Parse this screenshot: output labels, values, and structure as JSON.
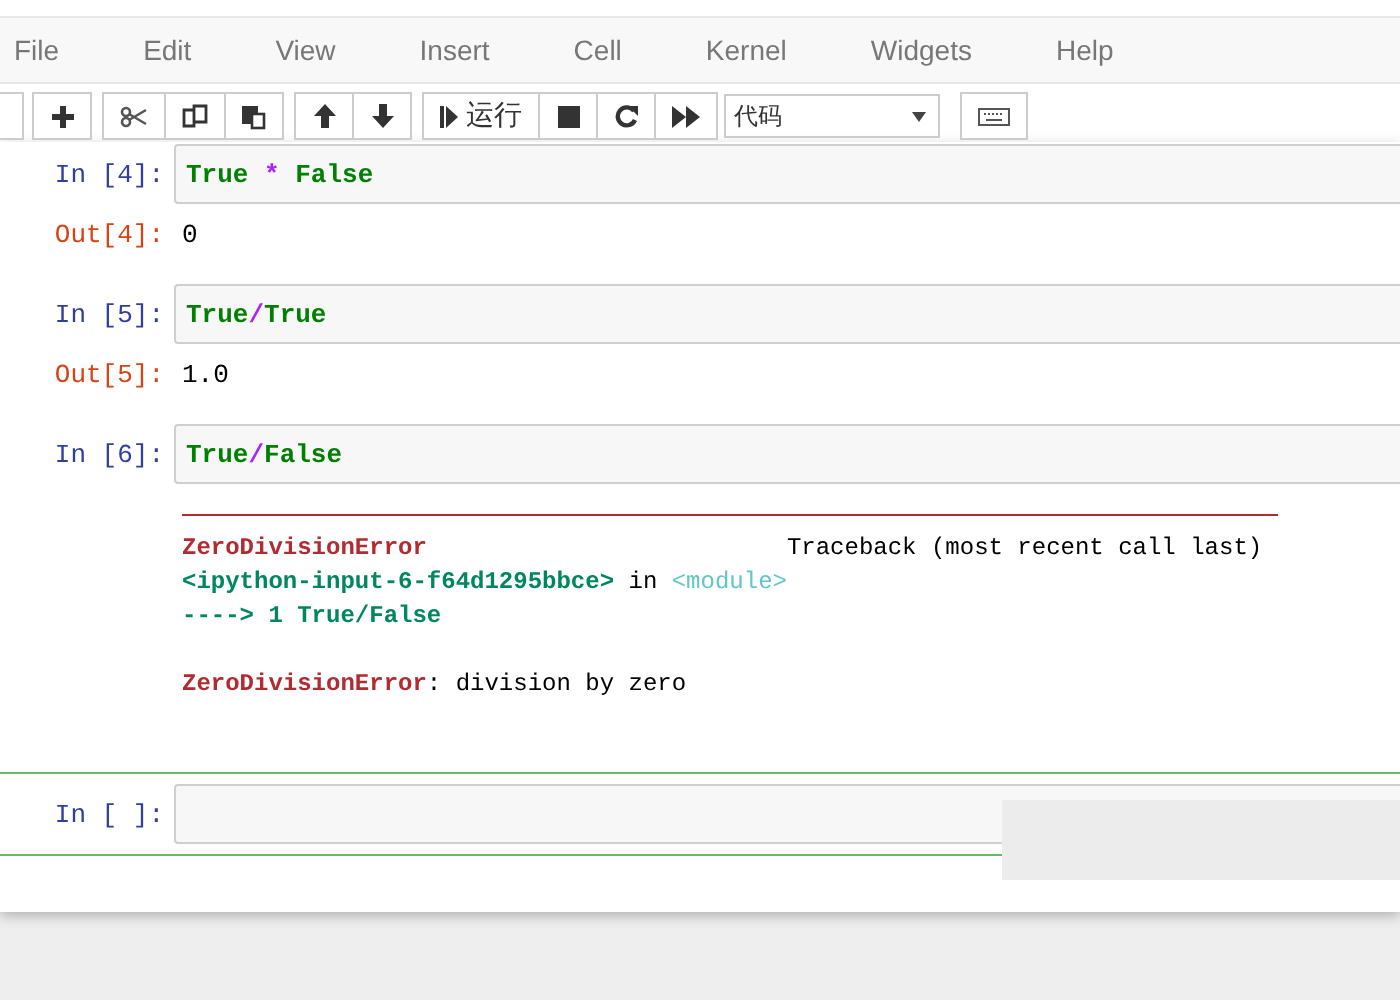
{
  "menu": [
    "File",
    "Edit",
    "View",
    "Insert",
    "Cell",
    "Kernel",
    "Widgets",
    "Help"
  ],
  "toolbar": {
    "groups": [
      [
        {
          "kind": "blank"
        }
      ],
      [
        {
          "kind": "add"
        }
      ],
      [
        {
          "kind": "cut"
        },
        {
          "kind": "copy"
        },
        {
          "kind": "paste"
        }
      ],
      [
        {
          "kind": "up"
        },
        {
          "kind": "down"
        }
      ],
      [
        {
          "kind": "run",
          "label": "运行"
        },
        {
          "kind": "stop"
        },
        {
          "kind": "restart"
        },
        {
          "kind": "fastforward"
        }
      ]
    ],
    "cell_type": "代码"
  },
  "cells": [
    {
      "prompt": "In [4]:",
      "code": [
        {
          "kind": "keyword",
          "text": "True"
        },
        {
          "kind": "operator",
          "text": " * "
        },
        {
          "kind": "keyword",
          "text": "False"
        }
      ],
      "out_prompt": "Out[4]:",
      "output": "0",
      "selected": false
    },
    {
      "prompt": "In [5]:",
      "code": [
        {
          "kind": "keyword",
          "text": "True"
        },
        {
          "kind": "operator",
          "text": "/"
        },
        {
          "kind": "keyword",
          "text": "True"
        }
      ],
      "out_prompt": "Out[5]:",
      "output": "1.0",
      "selected": false
    },
    {
      "prompt": "In [6]:",
      "code": [
        {
          "kind": "keyword",
          "text": "True"
        },
        {
          "kind": "operator",
          "text": "/"
        },
        {
          "kind": "keyword",
          "text": "False"
        }
      ],
      "traceback": [
        {
          "tokens": [
            {
              "kind": "ename",
              "text": "ZeroDivisionError"
            },
            {
              "kind": "plain",
              "text": "                         Traceback (most recent call last)"
            }
          ]
        },
        {
          "tokens": [
            {
              "kind": "path",
              "text": "<ipython-input-6-f64d1295bbce>"
            },
            {
              "kind": "plain",
              "text": " in "
            },
            {
              "kind": "module",
              "text": "<module>"
            }
          ]
        },
        {
          "tokens": [
            {
              "kind": "path",
              "text": "----> 1 True/False"
            }
          ]
        }
      ],
      "error": [
        {
          "kind": "ename",
          "text": "ZeroDivisionError"
        },
        {
          "kind": "plain",
          "text": ": division by zero"
        }
      ],
      "selected": false
    },
    {
      "prompt": "In [ ]:",
      "selected": true
    }
  ]
}
